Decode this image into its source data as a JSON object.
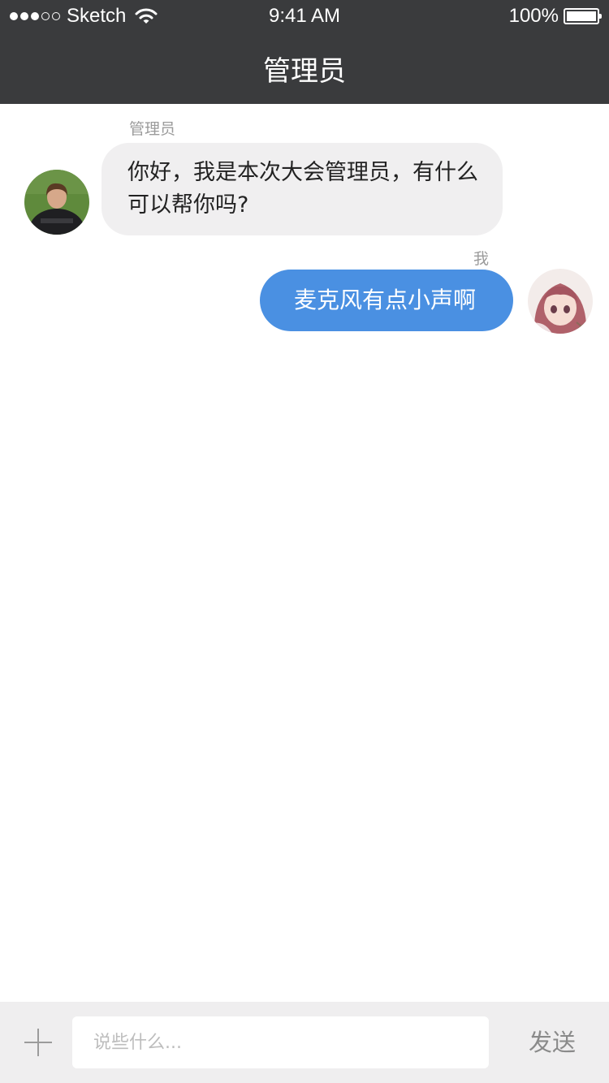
{
  "status_bar": {
    "carrier": "Sketch",
    "time": "9:41 AM",
    "battery": "100%",
    "battery_level": 1.0,
    "signal_bars_filled": 3,
    "signal_bars_total": 5
  },
  "nav": {
    "title": "管理员"
  },
  "messages": [
    {
      "sender": "管理员",
      "direction": "incoming",
      "text": "你好，我是本次大会管理员，有什么可以帮你吗?",
      "avatar_icon": "admin-avatar"
    },
    {
      "sender": "我",
      "direction": "outgoing",
      "text": "麦克风有点小声啊",
      "avatar_icon": "user-avatar"
    }
  ],
  "composer": {
    "placeholder": "说些什么...",
    "send_label": "发送",
    "add_icon": "plus-icon"
  },
  "colors": {
    "nav_background": "#3a3b3d",
    "incoming_bubble": "#f0eff0",
    "outgoing_bubble": "#4a90e2",
    "composer_background": "#efeeef"
  }
}
